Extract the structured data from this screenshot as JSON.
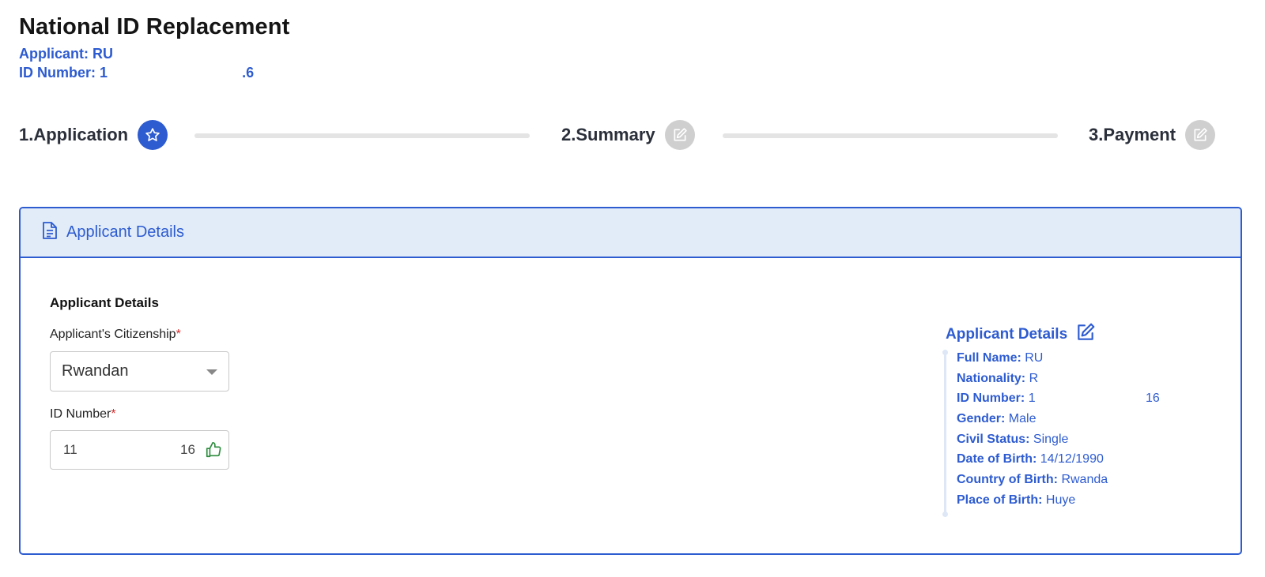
{
  "header": {
    "title": "National ID Replacement",
    "applicant_label": "Applicant:",
    "applicant_value": "RU",
    "id_label": "ID Number:",
    "id_value_start": "1",
    "id_value_end": ".6"
  },
  "stepper": {
    "steps": [
      {
        "label": "1.Application",
        "icon": "star-icon",
        "state": "active"
      },
      {
        "label": "2.Summary",
        "icon": "edit-icon",
        "state": "inactive"
      },
      {
        "label": "3.Payment",
        "icon": "edit-icon",
        "state": "inactive"
      }
    ]
  },
  "card": {
    "header_title": "Applicant Details",
    "header_icon": "document-icon",
    "section_title": "Applicant Details",
    "citizenship_label": "Applicant's Citizenship",
    "required_mark": "*",
    "citizenship_value": "Rwandan",
    "id_number_label": "ID Number",
    "id_number_value_start": "11",
    "id_number_value_end": "16",
    "valid_icon": "thumbs-up-icon"
  },
  "details": {
    "title": "Applicant Details",
    "edit_icon": "edit-icon",
    "rows": [
      {
        "label": "Full Name:",
        "value": "RU"
      },
      {
        "label": "Nationality:",
        "value": "R"
      },
      {
        "label": "ID Number:",
        "value": "1",
        "value_end": "16"
      },
      {
        "label": "Gender:",
        "value": "Male"
      },
      {
        "label": "Civil Status:",
        "value": "Single"
      },
      {
        "label": "Date of Birth:",
        "value": "14/12/1990"
      },
      {
        "label": "Country of Birth:",
        "value": "Rwanda"
      },
      {
        "label": "Place of Birth:",
        "value": "Huye"
      }
    ]
  },
  "colors": {
    "accent": "#2d5bd0",
    "header_bg": "#e1ecf8",
    "inactive_step": "#cfcfcf",
    "required": "#d62b2b",
    "valid_green": "#2e8b3e"
  }
}
